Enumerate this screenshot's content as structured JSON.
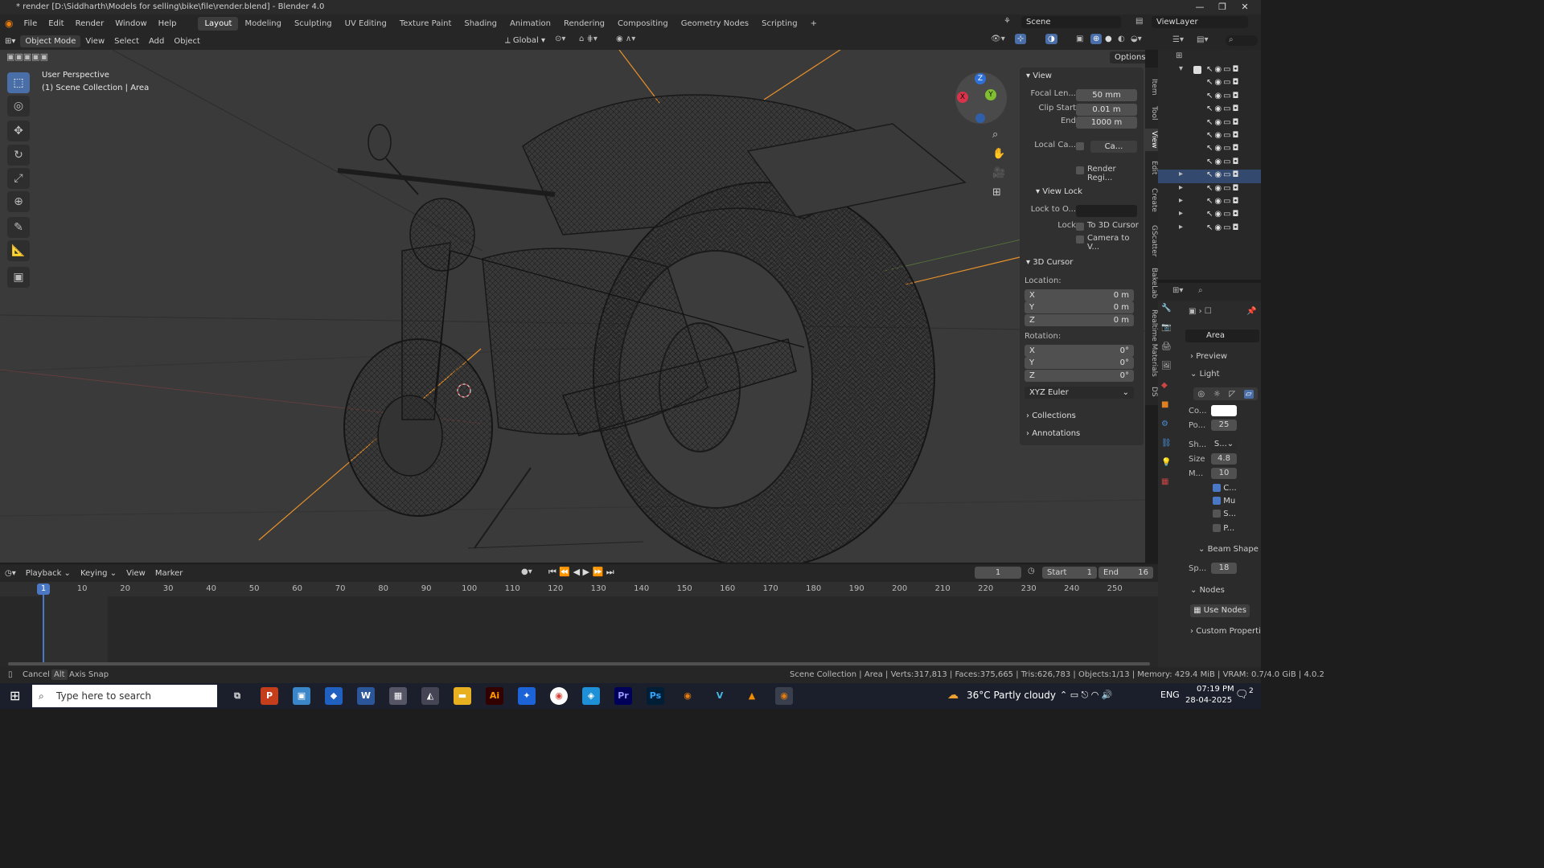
{
  "title": "* render [D:\\Siddharth\\Models for selling\\bike\\file\\render.blend] - Blender 4.0",
  "menu": [
    "File",
    "Edit",
    "Render",
    "Window",
    "Help"
  ],
  "workspaces": [
    "Layout",
    "Modeling",
    "Sculpting",
    "UV Editing",
    "Texture Paint",
    "Shading",
    "Animation",
    "Rendering",
    "Compositing",
    "Geometry Nodes",
    "Scripting"
  ],
  "active_workspace": "Layout",
  "scene": "Scene",
  "view_layer": "ViewLayer",
  "viewport_header": {
    "mode": "Object Mode",
    "menus": [
      "View",
      "Select",
      "Add",
      "Object"
    ],
    "transform": "Global",
    "options": "Options"
  },
  "viewport_overlay": {
    "line1": "User Perspective",
    "line2": "(1) Scene Collection | Area"
  },
  "gizmo": {
    "x": "X",
    "y": "Y",
    "z": "Z"
  },
  "npanel": {
    "view_title": "View",
    "focal_label": "Focal Len...",
    "focal_value": "50 mm",
    "clip_start_label": "Clip Start",
    "clip_start_value": "0.01 m",
    "end_label": "End",
    "end_value": "1000 m",
    "local_cam_label": "Local Ca...",
    "local_cam_value": "Ca...",
    "render_region": "Render Regi...",
    "view_lock_title": "View Lock",
    "lock_to_label": "Lock to O...",
    "lock_label": "Lock",
    "to_3d_cursor": "To 3D Cursor",
    "camera_to_view": "Camera to V...",
    "cursor_title": "3D Cursor",
    "location_label": "Location:",
    "loc": [
      {
        "axis": "X",
        "value": "0 m"
      },
      {
        "axis": "Y",
        "value": "0 m"
      },
      {
        "axis": "Z",
        "value": "0 m"
      }
    ],
    "rotation_label": "Rotation:",
    "rot": [
      {
        "axis": "X",
        "value": "0°"
      },
      {
        "axis": "Y",
        "value": "0°"
      },
      {
        "axis": "Z",
        "value": "0°"
      }
    ],
    "rotation_mode": "XYZ Euler",
    "collections": "Collections",
    "annotations": "Annotations"
  },
  "vtabs": [
    "Item",
    "Tool",
    "View",
    "Edit",
    "Create",
    "GScatter",
    "BakeLab",
    "Realtime Materials",
    "DS"
  ],
  "properties": {
    "object_name": "Area",
    "preview": "Preview",
    "light": "Light",
    "color_label": "Co...",
    "power_label": "Po...",
    "power_value": "25",
    "shape_label": "Sh...",
    "shape_value": "S...",
    "size_label": "Size",
    "size_value": "4.8",
    "m_label": "M...",
    "m_value": "10",
    "cb1": "C...",
    "cb2": "Mu",
    "cb3": "S...",
    "cb4": "P...",
    "beam_shape": "Beam Shape",
    "spread_label": "Sp...",
    "spread_value": "18",
    "nodes": "Nodes",
    "use_nodes": "Use Nodes",
    "custom_props": "Custom Properti"
  },
  "timeline": {
    "menus": [
      "Playback",
      "Keying",
      "View",
      "Marker"
    ],
    "current_frame": "1",
    "start_label": "Start",
    "start_value": "1",
    "end_label": "End",
    "end_value": "16",
    "ticks": [
      "10",
      "20",
      "30",
      "40",
      "50",
      "60",
      "70",
      "80",
      "90",
      "100",
      "110",
      "120",
      "130",
      "140",
      "150",
      "160",
      "170",
      "180",
      "190",
      "200",
      "210",
      "220",
      "230",
      "240",
      "250"
    ],
    "playhead_label": "1"
  },
  "status": {
    "left1": "Cancel",
    "left2_key": "Alt",
    "left2": "Axis Snap",
    "right": "Scene Collection | Area | Verts:317,813 | Faces:375,665 | Tris:626,783 | Objects:1/13 | Memory: 429.4 MiB | VRAM: 0.7/4.0 GiB | 4.0.2"
  },
  "taskbar": {
    "search": "Type here to search",
    "weather": "36°C  Partly cloudy",
    "lang": "ENG",
    "time": "07:19 PM",
    "date": "28-04-2025",
    "notif": "2"
  }
}
